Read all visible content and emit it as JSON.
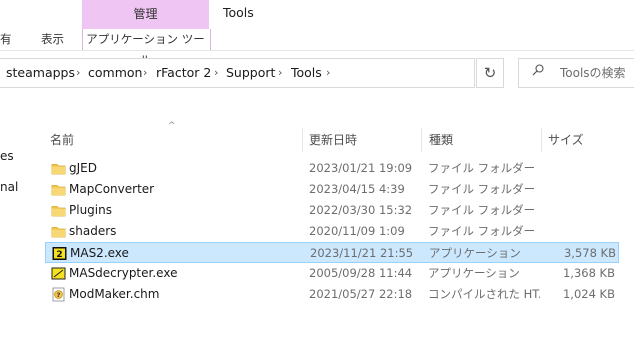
{
  "ribbon": {
    "context_group_label": "管理",
    "context_tab_label": "アプリケーション ツール",
    "window_title": "Tools",
    "partial_tab_left": "有",
    "view_tab": "表示"
  },
  "address": {
    "crumbs": [
      "steamapps",
      "common",
      "rFactor 2",
      "Support",
      "Tools"
    ],
    "chevron": "›",
    "refresh": "↻"
  },
  "search": {
    "placeholder": "Toolsの検索"
  },
  "nav_fragments": [
    "es",
    "nal"
  ],
  "columns": {
    "name": "名前",
    "date": "更新日時",
    "type": "種類",
    "size": "サイズ",
    "sort_indicator": "^"
  },
  "files": [
    {
      "name": "gJED",
      "date": "2023/01/21 19:09",
      "type": "ファイル フォルダー",
      "size": "",
      "icon": "folder-icon",
      "selected": false
    },
    {
      "name": "MapConverter",
      "date": "2023/04/15 4:39",
      "type": "ファイル フォルダー",
      "size": "",
      "icon": "folder-icon",
      "selected": false
    },
    {
      "name": "Plugins",
      "date": "2022/03/30 15:32",
      "type": "ファイル フォルダー",
      "size": "",
      "icon": "folder-icon",
      "selected": false
    },
    {
      "name": "shaders",
      "date": "2020/11/09 1:09",
      "type": "ファイル フォルダー",
      "size": "",
      "icon": "folder-icon",
      "selected": false
    },
    {
      "name": "MAS2.exe",
      "date": "2023/11/21 21:55",
      "type": "アプリケーション",
      "size": "3,578 KB",
      "icon": "mas2-app-icon",
      "selected": true
    },
    {
      "name": "MASdecrypter.exe",
      "date": "2005/09/28 11:44",
      "type": "アプリケーション",
      "size": "1,368 KB",
      "icon": "app-exe-icon",
      "selected": false
    },
    {
      "name": "ModMaker.chm",
      "date": "2021/05/27 22:18",
      "type": "コンパイルされた HT...",
      "size": "1,024 KB",
      "icon": "help-file-icon",
      "selected": false
    }
  ],
  "colors": {
    "context_tab": "#efc6f3",
    "selected_row": "#cce8ff",
    "selected_border": "#99d1ff",
    "folder": "#f0c14b"
  }
}
